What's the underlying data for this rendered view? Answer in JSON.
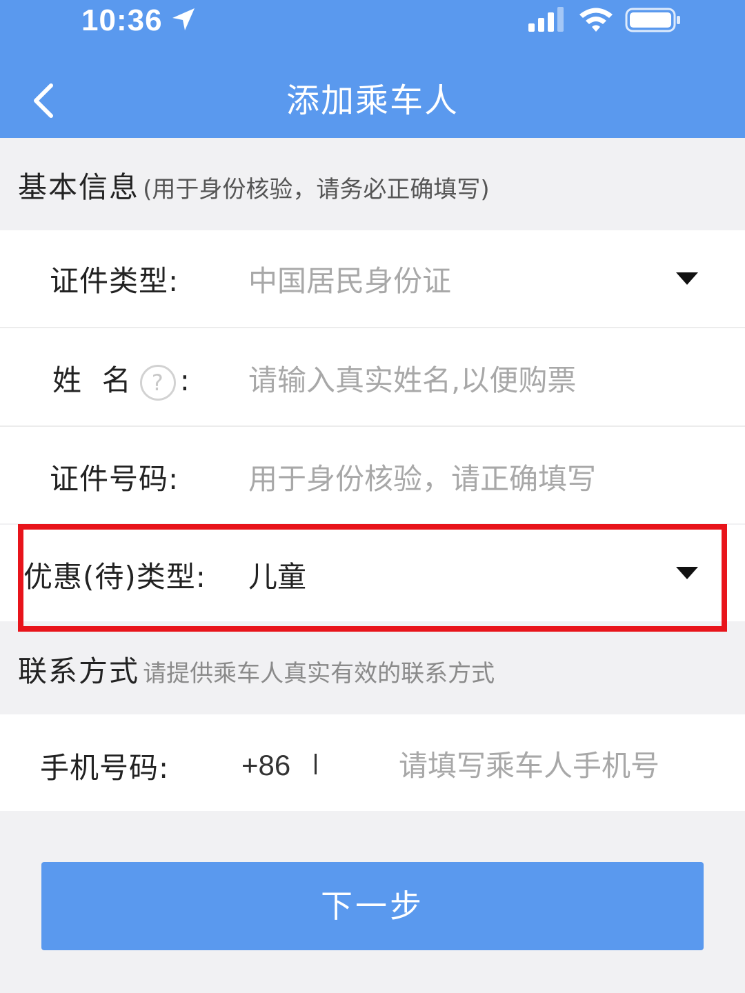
{
  "status_bar": {
    "time": "10:36"
  },
  "nav": {
    "title": "添加乘车人"
  },
  "basic_info": {
    "title": "基本信息",
    "hint": "(用于身份核验，请务必正确填写)"
  },
  "fields": {
    "id_type": {
      "label": "证件类型:",
      "value": "中国居民身份证"
    },
    "name": {
      "label": "姓  名",
      "colon": ":",
      "placeholder": "请输入真实姓名,以便购票",
      "help": "?"
    },
    "id_number": {
      "label": "证件号码:",
      "placeholder": "用于身份核验，请正确填写"
    },
    "discount_type": {
      "label": "优惠(待)类型:",
      "value": "儿童"
    }
  },
  "contact": {
    "title": "联系方式",
    "hint": "请提供乘车人真实有效的联系方式",
    "phone": {
      "label": "手机号码:",
      "prefix": "+86",
      "placeholder": "请填写乘车人手机号"
    }
  },
  "next_button": {
    "label": "下一步"
  },
  "colors": {
    "accent": "#5a99ee",
    "highlight": "#e8141b"
  }
}
